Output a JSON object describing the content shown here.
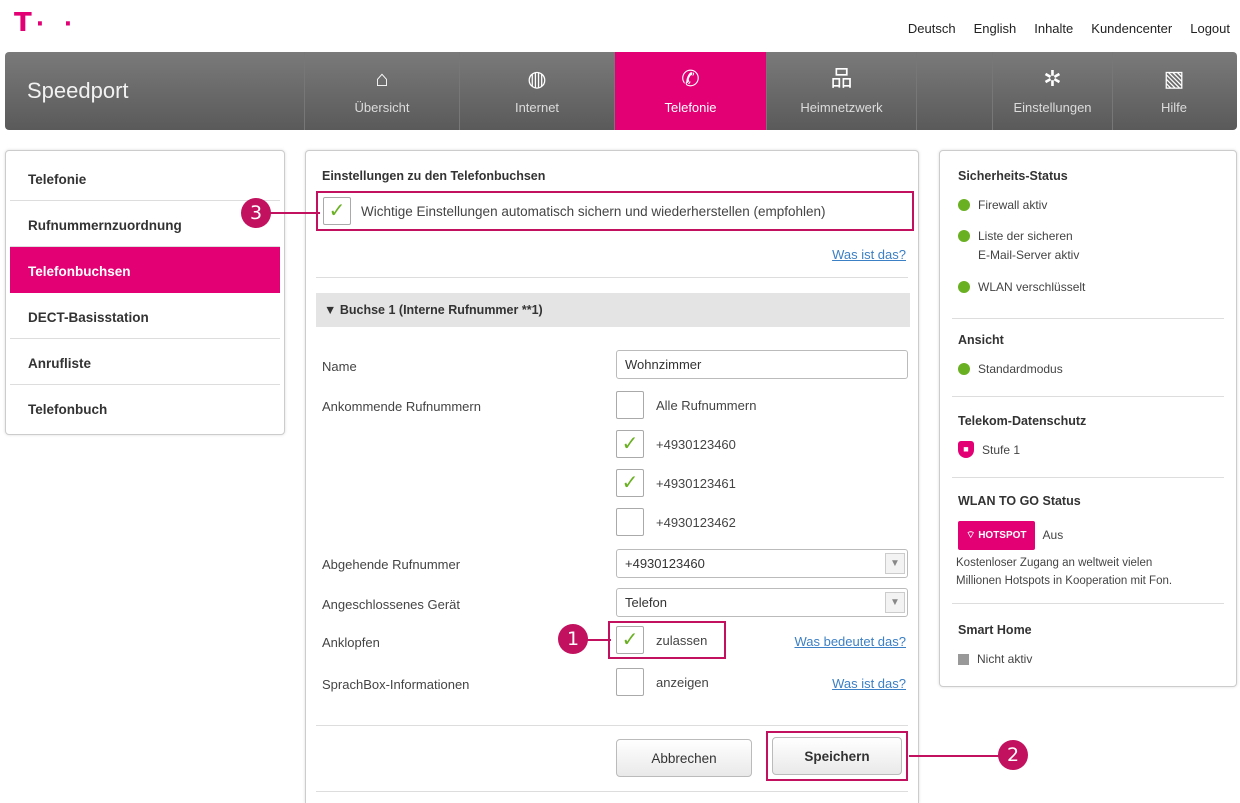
{
  "topbar": {
    "logo": "T",
    "logo_dots": "· ·",
    "links": [
      "Deutsch",
      "English",
      "Inhalte",
      "Kundencenter",
      "Logout"
    ]
  },
  "nav": {
    "brand": "Speedport",
    "items": [
      {
        "label": "Übersicht",
        "icon": "home-icon"
      },
      {
        "label": "Internet",
        "icon": "globe-icon"
      },
      {
        "label": "Telefonie",
        "icon": "phone-icon"
      },
      {
        "label": "Heimnetzwerk",
        "icon": "network-icon"
      },
      {
        "label": "Einstellungen",
        "icon": "gear-icon"
      },
      {
        "label": "Hilfe",
        "icon": "help-icon"
      }
    ]
  },
  "sidebar": {
    "items": [
      {
        "label": "Telefonie"
      },
      {
        "label": "Rufnummernzuordnung"
      },
      {
        "label": "Telefonbuchsen"
      },
      {
        "label": "DECT-Basisstation"
      },
      {
        "label": "Anrufliste"
      },
      {
        "label": "Telefonbuch"
      }
    ]
  },
  "main": {
    "section_title": "Einstellungen zu den Telefonbuchsen",
    "autosave_label": "Wichtige Einstellungen automatisch sichern und wiederherstellen (empfohlen)",
    "help_link": "Was ist das?",
    "accordion_title": "Buchse 1 (Interne Rufnummer **1)",
    "name_label": "Name",
    "name_value": "Wohnzimmer",
    "incoming_label": "Ankommende Rufnummern",
    "incoming": [
      {
        "label": "Alle Rufnummern",
        "checked": false
      },
      {
        "label": "+4930123460",
        "checked": true
      },
      {
        "label": "+4930123461",
        "checked": true
      },
      {
        "label": "+4930123462",
        "checked": false
      }
    ],
    "outgoing_label": "Abgehende Rufnummer",
    "outgoing_value": "+4930123460",
    "device_label": "Angeschlossenes Gerät",
    "device_value": "Telefon",
    "callwaiting_label": "Anklopfen",
    "callwaiting_option": "zulassen",
    "callwaiting_link": "Was bedeutet das?",
    "sprachbox_label": "SprachBox-Informationen",
    "sprachbox_option": "anzeigen",
    "sprachbox_link": "Was ist das?",
    "cancel": "Abbrechen",
    "save": "Speichern"
  },
  "status": {
    "security_title": "Sicherheits-Status",
    "firewall": "Firewall aktiv",
    "mailserver_1": "Liste der sicheren",
    "mailserver_2": "E-Mail-Server aktiv",
    "wlan": "WLAN verschlüsselt",
    "view_title": "Ansicht",
    "view_mode": "Standardmodus",
    "privacy_title": "Telekom-Datenschutz",
    "privacy_level": "Stufe 1",
    "wlantogo_title": "WLAN TO GO Status",
    "hotspot_badge": "HOTSPOT",
    "hotspot_state": "Aus",
    "wlantogo_desc_1": "Kostenloser Zugang an weltweit vielen",
    "wlantogo_desc_2": "Millionen Hotspots in Kooperation mit Fon.",
    "smarthome_title": "Smart Home",
    "smarthome_state": "Nicht aktiv"
  },
  "callouts": [
    "1",
    "2",
    "3"
  ],
  "colors": {
    "accent": "#e20074",
    "highlight": "#c2125f",
    "ok": "#6ab023",
    "link": "#3b7fc4"
  }
}
